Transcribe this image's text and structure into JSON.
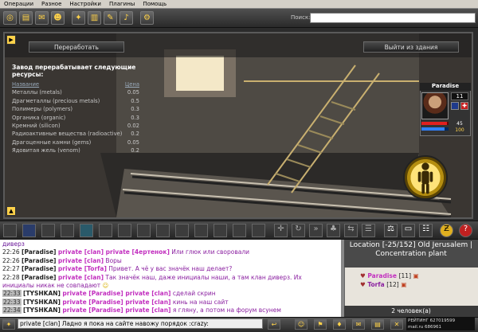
{
  "menu": [
    "Операции",
    "Разное",
    "Настройки",
    "Плагины",
    "Помощь"
  ],
  "search": {
    "label": "Поиск:",
    "value": ""
  },
  "game": {
    "process_button": "Переработать",
    "exit_button": "Выйти из здания",
    "info_title": "Завод перерабатывает следующие ресурсы:",
    "col_name": "Название",
    "col_price": "Цена",
    "resources": [
      {
        "name": "Металлы (metals)",
        "price": "0.05"
      },
      {
        "name": "Драгметаллы (precious metals)",
        "price": "0.5"
      },
      {
        "name": "Полимеры (polymers)",
        "price": "0.3"
      },
      {
        "name": "Органика (organic)",
        "price": "0.3"
      },
      {
        "name": "Кремний (silicon)",
        "price": "0.02"
      },
      {
        "name": "Радиоактивные вещества (radioactive)",
        "price": "0.2"
      },
      {
        "name": "Драгоценные камни (gems)",
        "price": "0.05"
      },
      {
        "name": "Ядовитая жель (venom)",
        "price": "0.2"
      }
    ]
  },
  "character": {
    "name": "Paradise",
    "level": "11",
    "stat1": "45",
    "stat2": "100",
    "hp": 0.95,
    "mp": 0.85
  },
  "chat": [
    {
      "prefix": "",
      "nick": "",
      "private": "",
      "text": "диверз"
    },
    {
      "time": "22:26",
      "nick": "[Paradise]",
      "private": "private [clan] private [4ертенок]",
      "text": "Или глюк или своровали"
    },
    {
      "time": "22:26",
      "nick": "[Paradise]",
      "private": "private [clan]",
      "text": "Воры"
    },
    {
      "time": "22:27",
      "nick": "[Paradise]",
      "private": "private [Torfa]",
      "text": "Привет. А чё у вас значёк наш делает?"
    },
    {
      "time": "22:28",
      "nick": "[Paradise]",
      "private": "private [clan]",
      "text": "Так значёк наш, даже инициалы наши, а там клан диверз. Их"
    },
    {
      "time": "",
      "nick": "",
      "private": "",
      "text": "инициалы никак не совпадают"
    },
    {
      "time": "22:33",
      "nick": "[TYSHKAN]",
      "private": "private [Paradise] private [clan]",
      "text": "сделай скрин"
    },
    {
      "time": "22:33",
      "nick": "[TYSHKAN]",
      "private": "private [Paradise] private [clan]",
      "text": "кинь на наш сайт"
    },
    {
      "time": "22:34",
      "nick": "[TYSHKAN]",
      "private": "private [Paradise] private [clan]",
      "text": "я гляну, а потом на форум всунем"
    }
  ],
  "location": {
    "title": "Location [-25/152] Old Jerusalem | Concentration plant",
    "users": [
      {
        "name": "Paradise",
        "level": "[11]"
      },
      {
        "name": "Torfa",
        "level": "[12]"
      }
    ],
    "online": "2 человек(а)"
  },
  "input": {
    "value": "private [clan] Ладно я пока на сайте навожу порядок :crazy:"
  },
  "counter": {
    "line1": "РЕЙТИНГ 627019599",
    "line2": "mail.ru 686961"
  },
  "colors": {
    "private": "#c22fbf",
    "message": "#8a1fa0",
    "hp": "#e02020",
    "mp": "#3080ff"
  }
}
